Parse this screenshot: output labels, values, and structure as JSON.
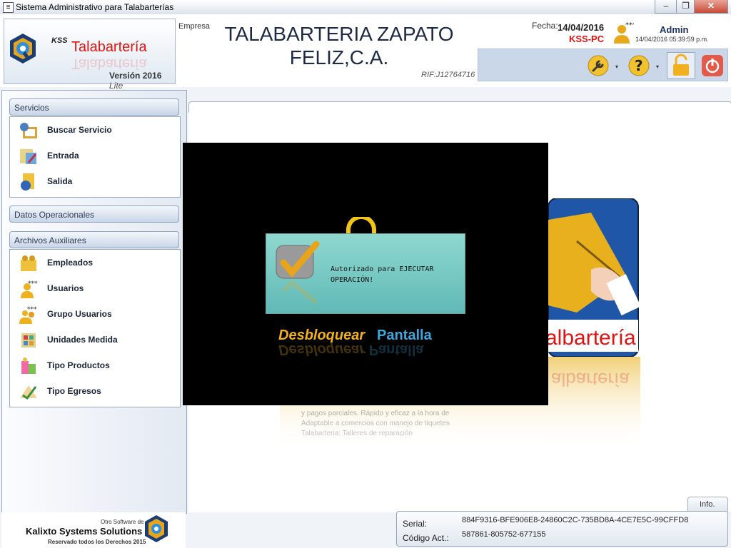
{
  "window": {
    "title": "Sistema Administrativo para Talabarterías",
    "min": "–",
    "max": "❐",
    "close": "✕"
  },
  "logo": {
    "kss": "KSS",
    "name": "Talabartería",
    "version": "Versión 2016",
    "edition": "Lite"
  },
  "company": {
    "label": "Empresa",
    "name": "TALABARTERIA ZAPATO FELIZ,C.A.",
    "rif": "RIF:J12764716"
  },
  "session": {
    "date_label": "Fecha:",
    "date": "14/04/2016",
    "pc": "KSS-PC",
    "user": "Admin",
    "login_time": "14/04/2016 05:39:59 p.m.",
    "stars": "***"
  },
  "toolbar": {
    "items": [
      "wrench-icon",
      "help-icon",
      "lock-icon",
      "power-icon"
    ],
    "arrow": "▾"
  },
  "sidebar": {
    "groups": [
      {
        "label": "Servicios",
        "items": [
          {
            "label": "Buscar Servicio"
          },
          {
            "label": "Entrada"
          },
          {
            "label": "Salida"
          }
        ]
      },
      {
        "label": "Datos Operacionales",
        "items": []
      },
      {
        "label": "Archivos Auxiliares",
        "items": [
          {
            "label": "Empleados"
          },
          {
            "label": "Usuarios"
          },
          {
            "label": "Grupo Usuarios"
          },
          {
            "label": "Unidades Medida"
          },
          {
            "label": "Tipo Productos"
          },
          {
            "label": "Tipo Egresos"
          }
        ]
      }
    ]
  },
  "brand": {
    "other": "Otro Software de",
    "name": "Kalixto Systems Solutions",
    "rights": "Reservado todos los Derechos 2015"
  },
  "splash": {
    "brand_text": "albartería",
    "reflection_line1": "Talabarteria: Talleres de reparación",
    "reflection_line2": "Adaptable a comercios con manejo de tiquetes",
    "reflection_line3": "y pagos parciales. Rápido y eficaz a la hora de"
  },
  "overlay": {
    "auth_message": "Autorizado para EJECUTAR OPERACIÓN!",
    "unlock_word1": "Desbloquear",
    "unlock_word2": "Pantalla"
  },
  "info_tab": "Info.",
  "status": {
    "serial_label": "Serial:",
    "serial": "884F9316-BFE906E8-24860C2C-735BD8A-4CE7E5C-99CFFD8",
    "code_label": "Código Act.:",
    "code": "587861-805752-677155"
  },
  "colors": {
    "accent_red": "#e01313",
    "navy": "#1e2a45",
    "gold": "#f3b21d",
    "blue": "#3fa7dc",
    "teal": "#61b9b6"
  }
}
